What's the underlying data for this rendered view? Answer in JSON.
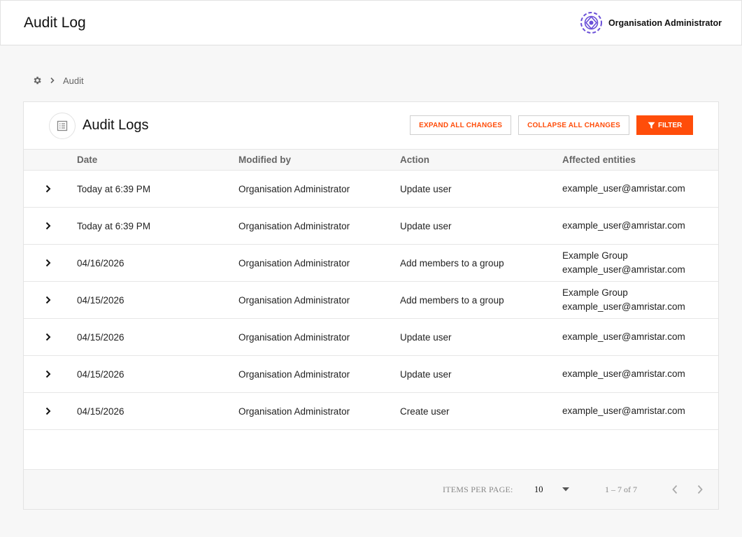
{
  "header": {
    "app_title": "Audit Log",
    "user_name": "Organisation Administrator"
  },
  "breadcrumb": {
    "current": "Audit"
  },
  "card": {
    "title": "Audit Logs",
    "expand_all_label": "EXPAND ALL CHANGES",
    "collapse_all_label": "COLLAPSE ALL CHANGES",
    "filter_label": "FILTER"
  },
  "table": {
    "columns": [
      "Date",
      "Modified by",
      "Action",
      "Affected entities"
    ],
    "rows": [
      {
        "date": "Today at 6:39 PM",
        "modified_by": "Organisation Administrator",
        "action": "Update user",
        "entities": [
          "example_user@amristar.com"
        ]
      },
      {
        "date": "Today at 6:39 PM",
        "modified_by": "Organisation Administrator",
        "action": "Update user",
        "entities": [
          "example_user@amristar.com"
        ]
      },
      {
        "date": "04/16/2026",
        "modified_by": "Organisation Administrator",
        "action": "Add members to a group",
        "entities": [
          "Example Group",
          "example_user@amristar.com"
        ]
      },
      {
        "date": "04/15/2026",
        "modified_by": "Organisation Administrator",
        "action": "Add members to a group",
        "entities": [
          "Example Group",
          "example_user@amristar.com"
        ]
      },
      {
        "date": "04/15/2026",
        "modified_by": "Organisation Administrator",
        "action": "Update user",
        "entities": [
          "example_user@amristar.com"
        ]
      },
      {
        "date": "04/15/2026",
        "modified_by": "Organisation Administrator",
        "action": "Update user",
        "entities": [
          "example_user@amristar.com"
        ]
      },
      {
        "date": "04/15/2026",
        "modified_by": "Organisation Administrator",
        "action": "Create user",
        "entities": [
          "example_user@amristar.com"
        ]
      }
    ]
  },
  "pagination": {
    "items_per_page_label": "ITEMS PER PAGE:",
    "items_per_page": "10",
    "range": "1 – 7 of 7"
  },
  "colors": {
    "accent": "#ff4d0a",
    "logo": "#6a4fd8"
  },
  "icons": {
    "breadcrumb_root": "gear-icon",
    "breadcrumb_sep": "chevron-right-icon",
    "card": "list-icon",
    "filter": "filter-icon",
    "row_expand": "chevron-right-icon",
    "select": "caret-down-icon",
    "prev": "chevron-left-icon",
    "next": "chevron-right-icon"
  }
}
